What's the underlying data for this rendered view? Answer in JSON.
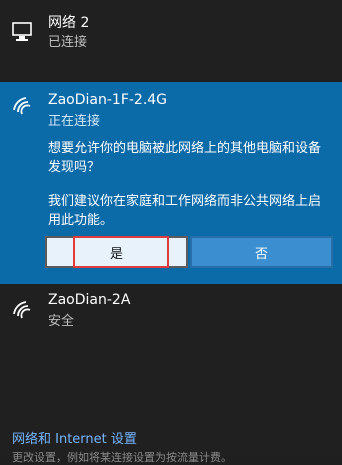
{
  "networks": {
    "wired": {
      "name": "网络 2",
      "status": "已连接",
      "icon": "computer-monitor-icon"
    },
    "selected_wifi": {
      "name": "ZaoDian-1F-2.4G",
      "status": "正在连接",
      "icon": "wifi-icon",
      "prompt": "想要允许你的电脑被此网络上的其他电脑和设备发现吗？",
      "advice": "我们建议你在家庭和工作网络而非公共网络上启用此功能。",
      "yes_label": "是",
      "no_label": "否"
    },
    "wifi2": {
      "name": "ZaoDian-2A",
      "status": "安全",
      "icon": "wifi-icon"
    }
  },
  "footer": {
    "settings_label": "网络和 Internet 设置",
    "settings_sub": "更改设置，例如将某连接设置为按流量计费。"
  },
  "colors": {
    "selected_bg": "#0b6aa8",
    "link": "#75b5ff"
  }
}
